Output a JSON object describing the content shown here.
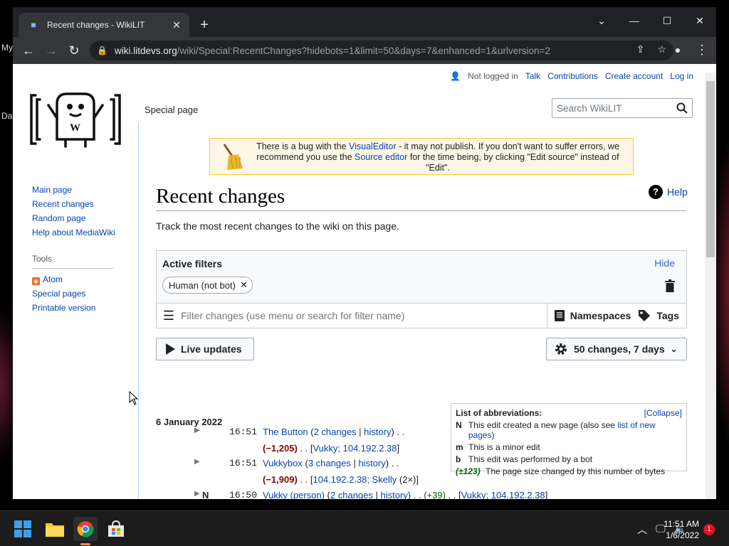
{
  "desktop": {
    "label_top": "My",
    "label_mid": "Da"
  },
  "browser": {
    "tab_title": "Recent changes - WikiLIT",
    "url_host": "wiki.litdevs.org",
    "url_rest": "/wiki/Special:RecentChanges?hidebots=1&limit=50&days=7&enhanced=1&urlversion=2"
  },
  "personal": {
    "not_logged_in": "Not logged in",
    "talk": "Talk",
    "contributions": "Contributions",
    "create_account": "Create account",
    "log_in": "Log in"
  },
  "sidebar": {
    "items": [
      "Main page",
      "Recent changes",
      "Random page",
      "Help about MediaWiki"
    ],
    "tools_heading": "Tools",
    "tools": [
      "Atom",
      "Special pages",
      "Printable version"
    ]
  },
  "tab_special": "Special page",
  "search_placeholder": "Search WikiLIT",
  "notice": {
    "p1": "There is a bug with the ",
    "link1": "VisualEditor",
    "p2": " - it may not publish. If you don't want to suffer errors, we recommend you use the ",
    "link2": "Source editor",
    "p3": " for the time being, by clicking \"Edit source\" instead of \"Edit\"."
  },
  "heading": "Recent changes",
  "help": "Help",
  "intro": "Track the most recent changes to the wiki on this page.",
  "filters": {
    "active": "Active filters",
    "hide": "Hide",
    "chip": "Human (not bot)",
    "placeholder": "Filter changes (use menu or search for filter name)",
    "namespaces": "Namespaces",
    "tags": "Tags"
  },
  "live_updates": "Live updates",
  "limit_label": "50 changes, 7 days",
  "day": "6 January 2022",
  "changes": [
    {
      "flag": "",
      "time": "16:51",
      "title": "The Button",
      "changes": "2 changes",
      "history": "history",
      "diff": "(−1,205)",
      "users": "Vukky; 104.192.2.38",
      "extra": ""
    },
    {
      "flag": "",
      "time": "16:51",
      "title": "Vukkybox",
      "changes": "3 changes",
      "history": "history",
      "diff": "(−1,909)",
      "users": "104.192.2.38; Skelly",
      "extra": "(2×)"
    },
    {
      "flag": "N",
      "time": "16:50",
      "title": "Vukky (person)",
      "changes": "2 changes",
      "history": "history",
      "diff": "(+39)",
      "users": "Vukky; 104.192.2.38",
      "extra": ""
    }
  ],
  "abbr": {
    "heading": "List of abbreviations:",
    "collapse": "[Collapse]",
    "items": [
      {
        "k": "N",
        "t": "This edit created a new page (also see ",
        "link": "list of new pages",
        "t2": ")"
      },
      {
        "k": "m",
        "t": "This is a minor edit",
        "link": "",
        "t2": ""
      },
      {
        "k": "b",
        "t": "This edit was performed by a bot",
        "link": "",
        "t2": ""
      },
      {
        "k": "(±123)",
        "t": "The page size changed by this number of bytes",
        "link": "",
        "t2": ""
      }
    ]
  },
  "taskbar": {
    "time": "11:51 AM",
    "date": "1/6/2022",
    "notifications": "1"
  },
  "colors": {
    "link": "#0645ad",
    "neg": "#8b0000",
    "pos": "#006400"
  }
}
